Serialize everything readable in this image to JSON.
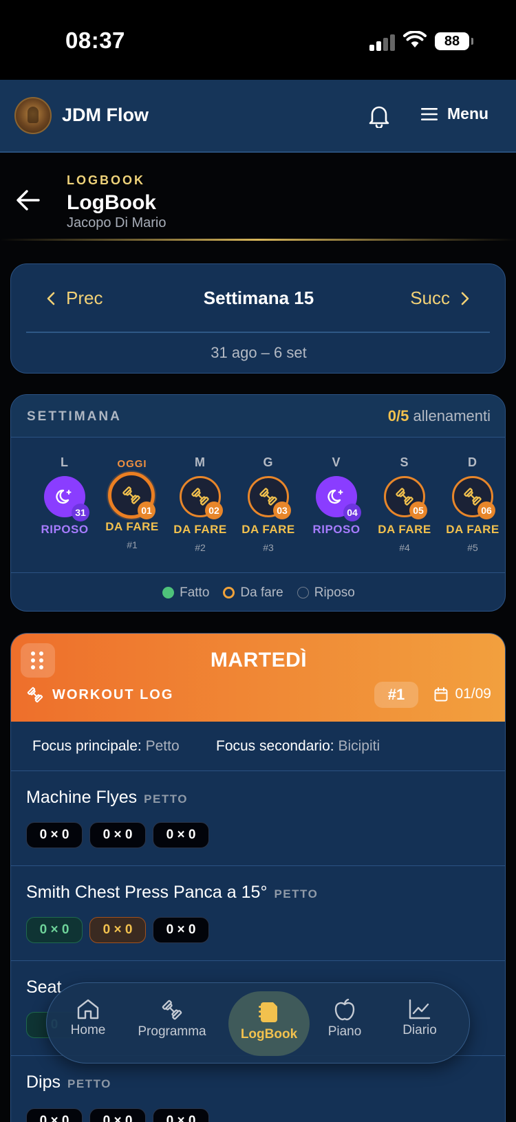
{
  "status_bar": {
    "time": "08:37",
    "battery": "88"
  },
  "app_header": {
    "title": "JDM Flow",
    "menu_label": "Menu"
  },
  "page_header": {
    "kicker": "LOGBOOK",
    "title": "LogBook",
    "subtitle": "Jacopo Di Mario"
  },
  "week_nav": {
    "prev_label": "Prec",
    "title": "Settimana 15",
    "next_label": "Succ",
    "range": "31 ago – 6 set"
  },
  "week_summary": {
    "label": "SETTIMANA",
    "count": "0/5",
    "count_suffix": "allenamenti",
    "days": [
      {
        "letter": "L",
        "status": "RIPOSO",
        "badge": "31",
        "num": ""
      },
      {
        "letter": "OGGI",
        "status": "DA FARE",
        "badge": "01",
        "num": "#1"
      },
      {
        "letter": "M",
        "status": "DA FARE",
        "badge": "02",
        "num": "#2"
      },
      {
        "letter": "G",
        "status": "DA FARE",
        "badge": "03",
        "num": "#3"
      },
      {
        "letter": "V",
        "status": "RIPOSO",
        "badge": "04",
        "num": ""
      },
      {
        "letter": "S",
        "status": "DA FARE",
        "badge": "05",
        "num": "#4"
      },
      {
        "letter": "D",
        "status": "DA FARE",
        "badge": "06",
        "num": "#5"
      }
    ],
    "legend": {
      "done": "Fatto",
      "todo": "Da fare",
      "rest": "Riposo"
    }
  },
  "workout": {
    "day": "MARTEDÌ",
    "label": "WORKOUT LOG",
    "number": "#1",
    "date": "01/09",
    "focus_primary_label": "Focus principale:",
    "focus_primary": "Petto",
    "focus_secondary_label": "Focus secondario:",
    "focus_secondary": "Bicipiti",
    "exercises": [
      {
        "name": "Machine Flyes",
        "tag": "PETTO",
        "sets": [
          "0 × 0",
          "0 × 0",
          "0 × 0"
        ]
      },
      {
        "name": "Smith Chest Press Panca a 15°",
        "tag": "PETTO",
        "sets": [
          "0 × 0",
          "0 × 0",
          "0 × 0"
        ]
      },
      {
        "name": "Seat",
        "tag": "",
        "sets": [
          "0"
        ]
      },
      {
        "name": "Dips",
        "tag": "PETTO",
        "sets": [
          "0 × 0",
          "0 × 0",
          "0 × 0"
        ]
      }
    ]
  },
  "bottom_nav": [
    {
      "label": "Home"
    },
    {
      "label": "Programma"
    },
    {
      "label": "LogBook"
    },
    {
      "label": "Piano"
    },
    {
      "label": "Diario"
    }
  ],
  "colors": {
    "accent": "#f2c14e",
    "orange": "#ee6f2b",
    "rest": "#8a3dff",
    "done": "#4ec27a",
    "card": "#143155"
  }
}
